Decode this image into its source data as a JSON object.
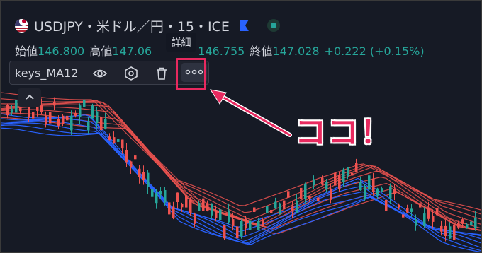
{
  "header": {
    "symbol_title": "USDJPY・米ドル／円・15・ICE",
    "flag_icon": "us-japan-flag-icon",
    "bookmark_color": "#2962ff",
    "status_color": "#26a69a"
  },
  "ohlc": {
    "open_label": "始値",
    "open_value": "146.800",
    "high_label": "高値",
    "high_value": "147.06",
    "low_value": "146.755",
    "close_label": "終値",
    "close_value": "147.028",
    "change": "+0.222 (+0.15%)"
  },
  "indicator": {
    "name": "keys_MA12",
    "icons": [
      "eye-icon",
      "settings-icon",
      "trash-icon",
      "more-icon"
    ],
    "more_tooltip": "詳細"
  },
  "annotation": {
    "text": "ココ！",
    "color": "#e8295f"
  },
  "colors": {
    "up": "#26a69a",
    "down": "#ef5350",
    "ma_fast": "#2962ff",
    "ma_slow": "#ef5350"
  }
}
